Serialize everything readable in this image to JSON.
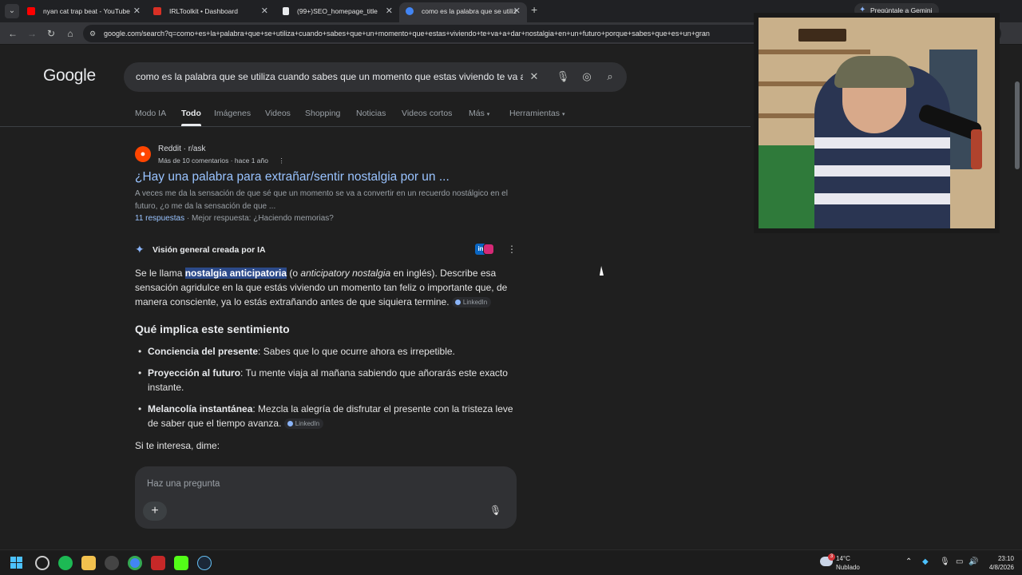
{
  "browser": {
    "tabs": [
      {
        "label": "nyan cat trap beat - YouTube",
        "favicon_color": "#ff0000"
      },
      {
        "label": "IRLToolkit • Dashboard",
        "favicon_color": "#d93025"
      },
      {
        "label": "(99+)SEO_homepage_title",
        "favicon_color": "#e8eaed"
      },
      {
        "label": "como es la palabra que se utiliz",
        "favicon_color": "#4285f4"
      }
    ],
    "gemini_button": "Pregúntale a Gemini",
    "url": "google.com/search?q=como+es+la+palabra+que+se+utiliza+cuando+sabes+que+un+momento+que+estas+viviendo+te+va+a+dar+nostalgia+en+un+futuro+porque+sabes+que+es+un+gran"
  },
  "google": {
    "logo": "Google",
    "query": "como es la palabra que se utiliza cuando sabes que un momento que estas viviendo te va a",
    "tabs": [
      "Modo IA",
      "Todo",
      "Imágenes",
      "Videos",
      "Shopping",
      "Noticias",
      "Videos cortos",
      "Más",
      "Herramientas"
    ],
    "active_tab": "Todo"
  },
  "result": {
    "site": "Reddit · r/ask",
    "meta": "Más de 10 comentarios · hace 1 año",
    "title": "¿Hay una palabra para extrañar/sentir nostalgia por un ...",
    "snippet": "A veces me da la sensación de que sé que un momento se va a convertir en un recuerdo nostálgico en el futuro, ¿o me da la sensación de que ...",
    "answers_link": "11 respuestas",
    "best_answer": "Mejor respuesta: ¿Haciendo memorias?"
  },
  "ai_overview": {
    "heading": "Visión general creada por IA",
    "intro_before": "Se le llama ",
    "intro_highlight": "nostalgia anticipatoria",
    "intro_mid": " (o ",
    "intro_italic": "anticipatory nostalgia",
    "intro_after": " en inglés). Describe esa sensación agridulce en la que estás viviendo un momento tan feliz o importante que, de manera consciente, ya lo estás extrañando antes de que siquiera termine.",
    "source_chip": "LinkedIn",
    "subheading": "Qué implica este sentimiento",
    "points": [
      {
        "term": "Conciencia del presente",
        "text": ": Sabes que lo que ocurre ahora es irrepetible."
      },
      {
        "term": "Proyección al futuro",
        "text": ": Tu mente viaja al mañana sabiendo que añorarás este exacto instante."
      },
      {
        "term": "Melancolía instantánea",
        "text": ": Mezcla la alegría de disfrutar el presente con la tristeza leve de saber que el tiempo avanza."
      }
    ],
    "tail": "Si te interesa, dime:",
    "ask_placeholder": "Haz una pregunta"
  },
  "taskbar": {
    "weather_temp": "14°C",
    "weather_desc": "Nublado",
    "weather_badge": "3",
    "time": "23:10",
    "date": "4/8/2026"
  }
}
